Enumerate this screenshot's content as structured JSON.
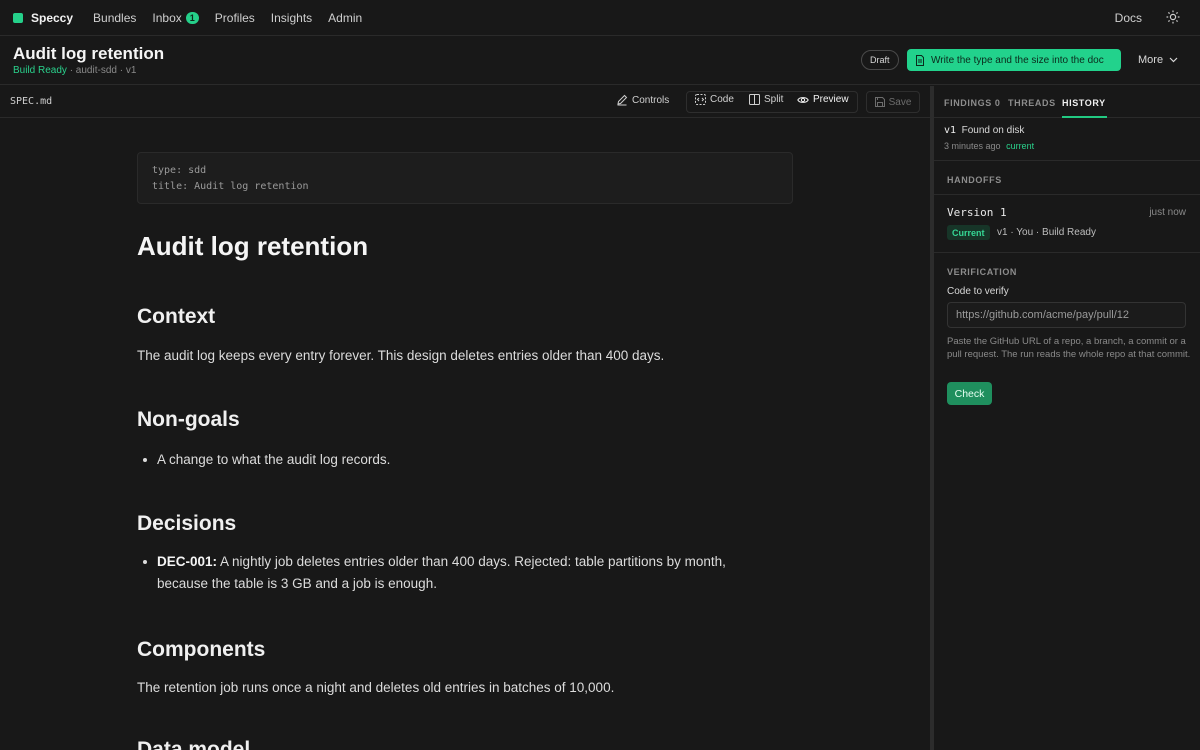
{
  "nav": {
    "brand": "Speccy",
    "items": [
      {
        "label": "Bundles"
      },
      {
        "label": "Inbox",
        "badge": "1"
      },
      {
        "label": "Profiles"
      },
      {
        "label": "Insights"
      },
      {
        "label": "Admin"
      }
    ],
    "docs": "Docs",
    "theme_icon": "sun-icon"
  },
  "header": {
    "title": "Audit log retention",
    "status": "Build Ready",
    "meta": " · audit-sdd · v1",
    "draft": "Draft",
    "primary_action": "Write the type and the size into the doc",
    "more": "More"
  },
  "toolbar": {
    "filename": "SPEC.md",
    "controls": "Controls",
    "code": "Code",
    "split": "Split",
    "preview": "Preview",
    "save": "Save"
  },
  "doc": {
    "frontmatter": [
      "type: sdd",
      "title: Audit log retention"
    ],
    "title": "Audit log retention",
    "sections": {
      "context": {
        "heading": "Context",
        "body": "The audit log keeps every entry forever. This design deletes entries older than 400 days."
      },
      "nongoals": {
        "heading": "Non-goals",
        "items": [
          "A change to what the audit log records."
        ]
      },
      "decisions": {
        "heading": "Decisions",
        "items": [
          {
            "id": "DEC-001:",
            "text": " A nightly job deletes entries older than 400 days. Rejected: table partitions by month, because the table is 3 GB and a job is enough."
          }
        ]
      },
      "components": {
        "heading": "Components",
        "body": "The retention job runs once a night and deletes old entries in batches of 10,000."
      },
      "datamodel": {
        "heading": "Data model"
      }
    }
  },
  "panel": {
    "tabs": {
      "findings": "FINDINGS 0",
      "threads": "THREADS",
      "history": "HISTORY"
    },
    "history": {
      "version": "v1",
      "event": "Found on disk",
      "time": "3 minutes ago",
      "current": "current"
    },
    "handoffs": {
      "label": "HANDOFFS",
      "version_name": "Version 1",
      "time": "just now",
      "badge": "Current",
      "meta": "v1 · You · Build Ready"
    },
    "verification": {
      "label": "VERIFICATION",
      "field_label": "Code to verify",
      "placeholder": "https://github.com/acme/pay/pull/12",
      "help": "Paste the GitHub URL of a repo, a branch, a commit or a pull request. The run reads the whole repo at that commit.",
      "button": "Check"
    }
  },
  "colors": {
    "accent": "#22d28c",
    "background": "#181818",
    "check_button": "#1f8f5e"
  }
}
